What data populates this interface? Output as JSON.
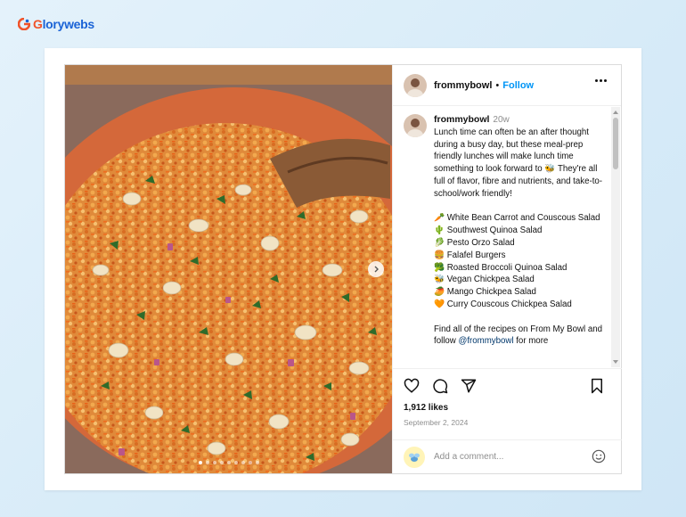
{
  "brand": {
    "prefix": "G",
    "name": "lorywebs"
  },
  "post": {
    "username": "frommybowl",
    "separator": "•",
    "follow_label": "Follow",
    "caption": {
      "username": "frommybowl",
      "time": "20w",
      "intro": "Lunch time can often be an after thought during a busy day, but these meal-prep friendly lunches will make lunch time something to look forward to 🐝 They're all full of flavor, fibre and nutrients, and take-to-school/work friendly!",
      "items": [
        "🥕 White Bean Carrot and Couscous Salad",
        "🌵 Southwest Quinoa Salad",
        "🥬 Pesto Orzo Salad",
        "🍔 Falafel Burgers",
        "🥦 Roasted Broccoli Quinoa Salad",
        "🐝 Vegan Chickpea Salad",
        "🥭 Mango Chickpea Salad",
        "🧡 Curry Couscous Chickpea Salad"
      ],
      "outro": "Find all of the recipes on From My Bowl and follow",
      "mention": "@frommybowl",
      "outro_end": "for more"
    },
    "likes": "1,912 likes",
    "date": "September 2, 2024",
    "comment_placeholder": "Add a comment...",
    "carousel": {
      "slides": 9,
      "active": 1
    }
  }
}
